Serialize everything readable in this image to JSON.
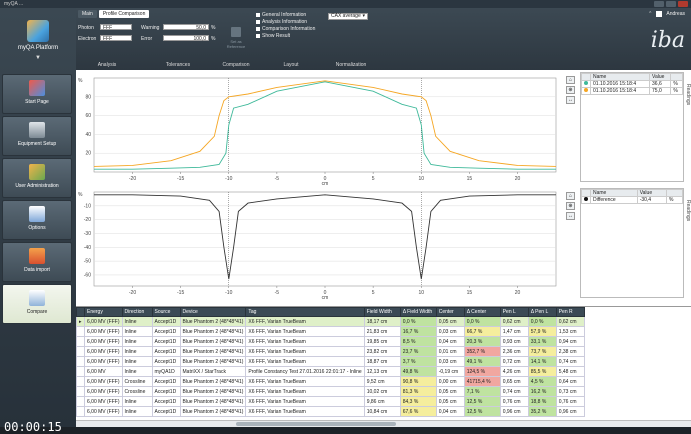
{
  "window": {
    "title": "myQA ..."
  },
  "sidebar": {
    "app_label": "myQA Platform",
    "items": [
      {
        "label": "Start Page"
      },
      {
        "label": "Equipment Setup"
      },
      {
        "label": "User Administration"
      },
      {
        "label": "Options"
      },
      {
        "label": "Data import"
      },
      {
        "label": "Compare"
      }
    ],
    "timer": "00:00:15"
  },
  "header": {
    "tabs": [
      "Main",
      "Profile Comparison"
    ],
    "user": "Andreas",
    "brand": "iba"
  },
  "analysis": {
    "photon_label": "Photon",
    "photon_value": "FFF",
    "electron_label": "Electron",
    "electron_value": "FFF",
    "section": "Analysis"
  },
  "tolerances": {
    "warning_label": "Warning",
    "warning_value": "50,0",
    "error_label": "Error",
    "error_value": "100,0",
    "unit": "%",
    "section": "Tolerances"
  },
  "comparison": {
    "button": "Set as Reference",
    "section": "Comparison"
  },
  "layout": {
    "options": [
      "General Information",
      "Analysis Information",
      "Comparison Information",
      "Show Result"
    ],
    "section": "Layout"
  },
  "normalization": {
    "value": "CAX average",
    "section": "Normalization"
  },
  "chart_data": [
    {
      "type": "line",
      "ylabel": "%",
      "xlabel": "cm",
      "xlim": [
        -24,
        24
      ],
      "xticks": [
        -20,
        -15,
        -10,
        -5,
        0,
        5,
        10,
        15,
        20
      ],
      "yticks": [
        20,
        40,
        60,
        80
      ],
      "series": [
        {
          "color": "#f5a623",
          "x": [
            -24,
            -20,
            -16,
            -13,
            -11.5,
            -11,
            -10.5,
            -10,
            -8,
            -5,
            0,
            5,
            8,
            10,
            10.5,
            11,
            11.5,
            13,
            16,
            20,
            24
          ],
          "y": [
            6,
            7,
            12,
            22,
            38,
            60,
            76,
            80,
            83,
            90,
            97,
            90,
            83,
            80,
            76,
            60,
            38,
            22,
            12,
            7,
            6
          ]
        },
        {
          "color": "#3fb99a",
          "x": [
            -24,
            -20,
            -16,
            -13,
            -11,
            -10.3,
            -10,
            -9.5,
            -8,
            -5,
            0,
            5,
            8,
            9.5,
            10,
            10.3,
            11,
            13,
            16,
            20,
            24
          ],
          "y": [
            3,
            3,
            4,
            5,
            8,
            20,
            50,
            68,
            72,
            86,
            96,
            86,
            72,
            68,
            50,
            20,
            8,
            5,
            4,
            3,
            3
          ]
        }
      ]
    },
    {
      "type": "line",
      "ylabel": "%",
      "xlabel": "cm",
      "xlim": [
        -24,
        24
      ],
      "xticks": [
        -20,
        -15,
        -10,
        -5,
        0,
        5,
        10,
        15,
        20
      ],
      "yticks": [
        -10,
        -20,
        -30,
        -40,
        -50,
        -60
      ],
      "series": [
        {
          "color": "#333333",
          "x": [
            -24,
            -20,
            -15,
            -12,
            -11,
            -10.5,
            -10,
            -9.5,
            -9,
            -8,
            -5,
            0,
            5,
            8,
            9,
            9.5,
            10,
            10.5,
            11,
            12,
            15,
            20,
            24
          ],
          "y": [
            -2,
            -2,
            -3,
            -6,
            -14,
            -40,
            -63,
            -40,
            -14,
            -8,
            -5,
            -2,
            -5,
            -8,
            -14,
            -40,
            -63,
            -40,
            -14,
            -6,
            -3,
            -2,
            -2
          ]
        }
      ]
    }
  ],
  "legend_top": {
    "headers": [
      "Name",
      "Value"
    ],
    "rows": [
      {
        "name": "01.10.2016 15:18:4",
        "value": "36,6",
        "unit": "%",
        "color": "#3fb99a"
      },
      {
        "name": "01.10.2016 15:18:4",
        "value": "75,0",
        "unit": "%",
        "color": "#f5a623"
      }
    ],
    "side_label": "Readings"
  },
  "legend_bottom": {
    "headers": [
      "Name",
      "Value"
    ],
    "rows": [
      {
        "name": "Difference",
        "value": "-30,4",
        "unit": "%",
        "color": "#111111"
      }
    ],
    "side_label": "Readings"
  },
  "table": {
    "headers": [
      "Energy",
      "Direction",
      "Source",
      "Device",
      "Tag",
      "Field Width",
      "Δ Field Width",
      "Center",
      "Δ Center",
      "Pen L",
      "Δ Pen L",
      "Pen R"
    ],
    "rows": [
      [
        "6,00 MV (FFF)",
        "Inline",
        "Accept1D",
        "Blue Phantom 2  (48*48*41)",
        "X6 FFF, Varian TrueBeam",
        "18,17 cm",
        "0,0 %",
        "0,05 cm",
        "0,0 %",
        "0,62 cm",
        "0,0 %",
        "0,62 cm"
      ],
      [
        "6,00 MV (FFF)",
        "Inline",
        "Accept1D",
        "Blue Phantom 2  (48*48*41)",
        "X6 FFF, Varian TrueBeam",
        "21,83 cm",
        "16,7 %",
        "0,03 cm",
        "66,7 %",
        "1,47 cm",
        "57,9 %",
        "1,53 cm"
      ],
      [
        "6,00 MV (FFF)",
        "Inline",
        "Accept1D",
        "Blue Phantom 2  (48*48*41)",
        "X6 FFF, Varian TrueBeam",
        "19,85 cm",
        "8,5 %",
        "0,04 cm",
        "20,3 %",
        "0,93 cm",
        "33,1 %",
        "0,94 cm"
      ],
      [
        "6,00 MV (FFF)",
        "Inline",
        "Accept1D",
        "Blue Phantom 2  (48*48*41)",
        "X6 FFF, Varian TrueBeam",
        "23,82 cm",
        "23,7 %",
        "0,01 cm",
        "352,7 %",
        "2,36 cm",
        "73,7 %",
        "2,38 cm"
      ],
      [
        "6,00 MV (FFF)",
        "Inline",
        "Accept1D",
        "Blue Phantom 2  (48*48*41)",
        "X6 FFF, Varian TrueBeam",
        "18,87 cm",
        "3,7 %",
        "0,03 cm",
        "49,1 %",
        "0,72 cm",
        "14,1 %",
        "0,74 cm"
      ],
      [
        "6,00 MV",
        "Inline",
        "myQA1D",
        "MatriXX / StarTrack",
        "Profile Constancy Test 27.01.2016 22:01:17 - Inline",
        "12,13 cm",
        "49,8 %",
        "-0,19 cm",
        "124,5 %",
        "4,26 cm",
        "85,5 %",
        "5,48 cm"
      ],
      [
        "6,00 MV (FFF)",
        "Crossline",
        "Accept1D",
        "Blue Phantom 2  (48*48*41)",
        "X6 FFF, Varian TrueBeam",
        "9,52 cm",
        "90,8 %",
        "0,00 cm",
        "41715,4 %",
        "0,65 cm",
        "4,5 %",
        "0,64 cm"
      ],
      [
        "6,00 MV (FFF)",
        "Crossline",
        "Accept1D",
        "Blue Phantom 2  (48*48*41)",
        "X6 FFF, Varian TrueBeam",
        "10,02 cm",
        "81,3 %",
        "0,05 cm",
        "7,1 %",
        "0,74 cm",
        "16,2 %",
        "0,73 cm"
      ],
      [
        "6,00 MV (FFF)",
        "Inline",
        "Accept1D",
        "Blue Phantom 2  (48*48*41)",
        "X6 FFF, Varian TrueBeam",
        "9,86 cm",
        "84,3 %",
        "0,05 cm",
        "12,5 %",
        "0,76 cm",
        "18,8 %",
        "0,76 cm"
      ],
      [
        "6,00 MV (FFF)",
        "Inline",
        "Accept1D",
        "Blue Phantom 2  (48*48*41)",
        "X6 FFF, Varian TrueBeam",
        "10,84 cm",
        "67,6 %",
        "0,04 cm",
        "12,5 %",
        "0,96 cm",
        "35,2 %",
        "0,96 cm"
      ]
    ],
    "status": [
      [
        "",
        "",
        "",
        "",
        "",
        "",
        "g",
        "",
        "g",
        "",
        "g",
        ""
      ],
      [
        "",
        "",
        "",
        "",
        "",
        "",
        "g",
        "",
        "y",
        "",
        "y",
        ""
      ],
      [
        "",
        "",
        "",
        "",
        "",
        "",
        "g",
        "",
        "g",
        "",
        "g",
        ""
      ],
      [
        "",
        "",
        "",
        "",
        "",
        "",
        "g",
        "",
        "r",
        "",
        "y",
        ""
      ],
      [
        "",
        "",
        "",
        "",
        "",
        "",
        "g",
        "",
        "g",
        "",
        "g",
        ""
      ],
      [
        "",
        "",
        "",
        "",
        "",
        "",
        "g",
        "",
        "r",
        "",
        "y",
        ""
      ],
      [
        "",
        "",
        "",
        "",
        "",
        "",
        "y",
        "",
        "r",
        "",
        "g",
        ""
      ],
      [
        "",
        "",
        "",
        "",
        "",
        "",
        "y",
        "",
        "g",
        "",
        "g",
        ""
      ],
      [
        "",
        "",
        "",
        "",
        "",
        "",
        "y",
        "",
        "g",
        "",
        "g",
        ""
      ],
      [
        "",
        "",
        "",
        "",
        "",
        "",
        "y",
        "",
        "g",
        "",
        "g",
        ""
      ]
    ]
  }
}
